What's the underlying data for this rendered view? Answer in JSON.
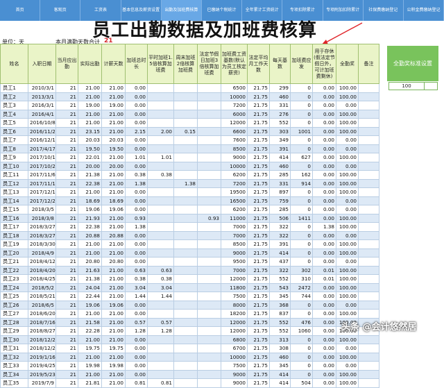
{
  "nav": [
    "首页",
    "客观页",
    "工资表",
    "基本信息及薪资设置",
    "出勤及加班费核算",
    "已缴纳个税统计",
    "全年累计工资统计",
    "专项扣除累计",
    "专项附加扣除累计",
    "社保费缴纳登记",
    "公积金费缴纳登记"
  ],
  "nav_active": 4,
  "title": "员工出勤数据及加班费核算",
  "unit_label": "单位：天",
  "std_days_label": "本月满勤天数合计",
  "std_days_value": "21",
  "headers": [
    "姓名",
    "入职日期",
    "当月应出勤",
    "实际出勤",
    "计薪天数",
    "加班总时长",
    "平时加班1.5倍核算加班费",
    "周末加班2倍核算加班费",
    "法定节假日加班3倍核算加班费",
    "加班费工资基数(默认为员工核定薪资)",
    "法定平均月工作天数",
    "每天基数",
    "加班费应发",
    "用于存休(假法定节假日外，可计加班费剩休)",
    "全勤奖",
    "备注"
  ],
  "rows": [
    [
      "员工1",
      "2010/3/1",
      "21",
      "21.00",
      "21.00",
      "0.00",
      "",
      "",
      "",
      "6500",
      "21.75",
      "299",
      "0",
      "0.00",
      "100.00",
      ""
    ],
    [
      "员工2",
      "2013/3/1",
      "21",
      "21.00",
      "21.00",
      "0.00",
      "",
      "",
      "",
      "10000",
      "21.75",
      "460",
      "0",
      "0.00",
      "100.00",
      ""
    ],
    [
      "员工3",
      "2016/3/1",
      "21",
      "19.00",
      "19.00",
      "0.00",
      "",
      "",
      "",
      "7200",
      "21.75",
      "331",
      "0",
      "0.00",
      "0.00",
      ""
    ],
    [
      "员工4",
      "2016/4/1",
      "21",
      "21.00",
      "21.00",
      "0.00",
      "",
      "",
      "",
      "6000",
      "21.75",
      "276",
      "0",
      "0.00",
      "100.00",
      ""
    ],
    [
      "员工5",
      "2016/10/8",
      "21",
      "21.00",
      "21.00",
      "0.00",
      "",
      "",
      "",
      "12000",
      "21.75",
      "552",
      "0",
      "0.00",
      "100.00",
      ""
    ],
    [
      "员工6",
      "2016/11/20",
      "21",
      "23.15",
      "21.00",
      "2.15",
      "2.00",
      "0.15",
      "",
      "6600",
      "21.75",
      "303",
      "1001",
      "0.00",
      "100.00",
      ""
    ],
    [
      "员工7",
      "2016/12/14",
      "21",
      "20.03",
      "20.03",
      "0.00",
      "",
      "",
      "",
      "7600",
      "21.75",
      "349",
      "0",
      "0.00",
      "0.00",
      ""
    ],
    [
      "员工8",
      "2017/4/17",
      "21",
      "19.50",
      "19.50",
      "0.00",
      "",
      "",
      "",
      "8500",
      "21.75",
      "391",
      "0",
      "0.00",
      "0.00",
      ""
    ],
    [
      "员工9",
      "2017/10/11",
      "21",
      "22.01",
      "21.00",
      "1.01",
      "1.01",
      "",
      "",
      "9000",
      "21.75",
      "414",
      "627",
      "0.00",
      "100.00",
      ""
    ],
    [
      "员工10",
      "2017/10/28",
      "21",
      "20.00",
      "20.00",
      "0.00",
      "",
      "",
      "",
      "10000",
      "21.75",
      "460",
      "0",
      "0.00",
      "0.00",
      ""
    ],
    [
      "员工11",
      "2017/11/6",
      "21",
      "21.38",
      "21.00",
      "0.38",
      "0.38",
      "",
      "",
      "6200",
      "21.75",
      "285",
      "162",
      "0.00",
      "100.00",
      ""
    ],
    [
      "员工12",
      "2017/11/14",
      "21",
      "22.38",
      "21.00",
      "1.38",
      "",
      "1.38",
      "",
      "7200",
      "21.75",
      "331",
      "914",
      "0.00",
      "100.00",
      ""
    ],
    [
      "员工13",
      "2017/12/16",
      "21",
      "21.00",
      "21.00",
      "0.00",
      "",
      "",
      "",
      "19500",
      "21.75",
      "897",
      "0",
      "0.00",
      "100.00",
      ""
    ],
    [
      "员工14",
      "2017/12/25",
      "21",
      "18.69",
      "18.69",
      "0.00",
      "",
      "",
      "",
      "16500",
      "21.75",
      "759",
      "0",
      "0.00",
      "0.00",
      ""
    ],
    [
      "员工15",
      "2018/3/5",
      "21",
      "19.06",
      "19.06",
      "0.00",
      "",
      "",
      "",
      "6200",
      "21.75",
      "285",
      "0",
      "0.00",
      "0.00",
      ""
    ],
    [
      "员工16",
      "2018/3/8",
      "21",
      "21.93",
      "21.00",
      "0.93",
      "",
      "",
      "0.93",
      "11000",
      "21.75",
      "506",
      "1411",
      "0.00",
      "100.00",
      ""
    ],
    [
      "员工17",
      "2018/3/27",
      "21",
      "22.38",
      "21.00",
      "1.38",
      "",
      "",
      "",
      "7000",
      "21.75",
      "322",
      "0",
      "1.38",
      "100.00",
      ""
    ],
    [
      "员工18",
      "2018/3/27",
      "21",
      "20.88",
      "20.88",
      "0.00",
      "",
      "",
      "",
      "7000",
      "21.75",
      "322",
      "0",
      "0.00",
      "0.00",
      ""
    ],
    [
      "员工19",
      "2018/3/30",
      "21",
      "21.00",
      "21.00",
      "0.00",
      "",
      "",
      "",
      "8500",
      "21.75",
      "391",
      "0",
      "0.00",
      "100.00",
      ""
    ],
    [
      "员工20",
      "2018/4/9",
      "21",
      "21.00",
      "21.00",
      "0.00",
      "",
      "",
      "",
      "9000",
      "21.75",
      "414",
      "0",
      "0.00",
      "100.00",
      ""
    ],
    [
      "员工21",
      "2018/4/12",
      "21",
      "20.80",
      "20.80",
      "0.00",
      "",
      "",
      "",
      "9500",
      "21.75",
      "437",
      "0",
      "0.00",
      "0.00",
      ""
    ],
    [
      "员工22",
      "2018/4/20",
      "21",
      "21.63",
      "21.00",
      "0.63",
      "0.63",
      "",
      "",
      "7000",
      "21.75",
      "322",
      "302",
      "0.01",
      "100.00",
      ""
    ],
    [
      "员工23",
      "2018/4/25",
      "21",
      "21.38",
      "21.00",
      "0.38",
      "0.38",
      "",
      "",
      "12000",
      "21.75",
      "552",
      "310",
      "0.01",
      "100.00",
      ""
    ],
    [
      "员工24",
      "2018/5/2",
      "21",
      "24.04",
      "21.00",
      "3.04",
      "3.04",
      "",
      "",
      "11800",
      "21.75",
      "543",
      "2472",
      "0.00",
      "100.00",
      ""
    ],
    [
      "员工25",
      "2018/5/21",
      "21",
      "22.44",
      "21.00",
      "1.44",
      "1.44",
      "",
      "",
      "7500",
      "21.75",
      "345",
      "744",
      "0.00",
      "100.00",
      ""
    ],
    [
      "员工26",
      "2018/6/5",
      "21",
      "19.06",
      "19.06",
      "0.00",
      "",
      "",
      "",
      "8000",
      "21.75",
      "368",
      "0",
      "0.00",
      "0.00",
      ""
    ],
    [
      "员工27",
      "2018/6/20",
      "21",
      "21.00",
      "21.00",
      "0.00",
      "",
      "",
      "",
      "18200",
      "21.75",
      "837",
      "0",
      "0.00",
      "100.00",
      ""
    ],
    [
      "员工28",
      "2018/7/16",
      "21",
      "21.58",
      "21.00",
      "0.57",
      "0.57",
      "",
      "",
      "12000",
      "21.75",
      "552",
      "476",
      "0.00",
      "100.00",
      ""
    ],
    [
      "员工29",
      "2018/8/27",
      "21",
      "22.28",
      "21.00",
      "1.28",
      "1.28",
      "",
      "",
      "12000",
      "21.75",
      "552",
      "1060",
      "0.00",
      "100.00",
      ""
    ],
    [
      "员工30",
      "2018/12/2",
      "21",
      "21.00",
      "21.00",
      "0.00",
      "",
      "",
      "",
      "6800",
      "21.75",
      "313",
      "0",
      "0.00",
      "100.00",
      ""
    ],
    [
      "员工31",
      "2018/12/24",
      "21",
      "19.75",
      "19.75",
      "0.00",
      "",
      "",
      "",
      "6700",
      "21.75",
      "308",
      "0",
      "0.00",
      "0.00",
      ""
    ],
    [
      "员工32",
      "2019/1/16",
      "21",
      "21.00",
      "21.00",
      "0.00",
      "",
      "",
      "",
      "10000",
      "21.75",
      "460",
      "0",
      "0.00",
      "100.00",
      ""
    ],
    [
      "员工33",
      "2019/4/25",
      "21",
      "19.98",
      "19.98",
      "0.00",
      "",
      "",
      "",
      "7500",
      "21.75",
      "345",
      "0",
      "0.00",
      "0.00",
      ""
    ],
    [
      "员工34",
      "2019/5/23",
      "21",
      "21.00",
      "21.00",
      "0.00",
      "",
      "",
      "",
      "9000",
      "21.75",
      "414",
      "0",
      "0.00",
      "100.00",
      ""
    ],
    [
      "员工35",
      "2019/7/9",
      "21",
      "21.81",
      "21.00",
      "0.81",
      "0.81",
      "",
      "",
      "9000",
      "21.75",
      "414",
      "504",
      "0.00",
      "100.00",
      ""
    ]
  ],
  "std_box_label": "全勤奖标准设置",
  "std_box_value": "100",
  "watermark": "头条 @会计悠然居",
  "colors": {
    "nav": "#4a8fd2",
    "header": "#eaf4c8",
    "row_alt": "#dde9f6",
    "box": "#79c35c",
    "accent": "#d4262b"
  }
}
